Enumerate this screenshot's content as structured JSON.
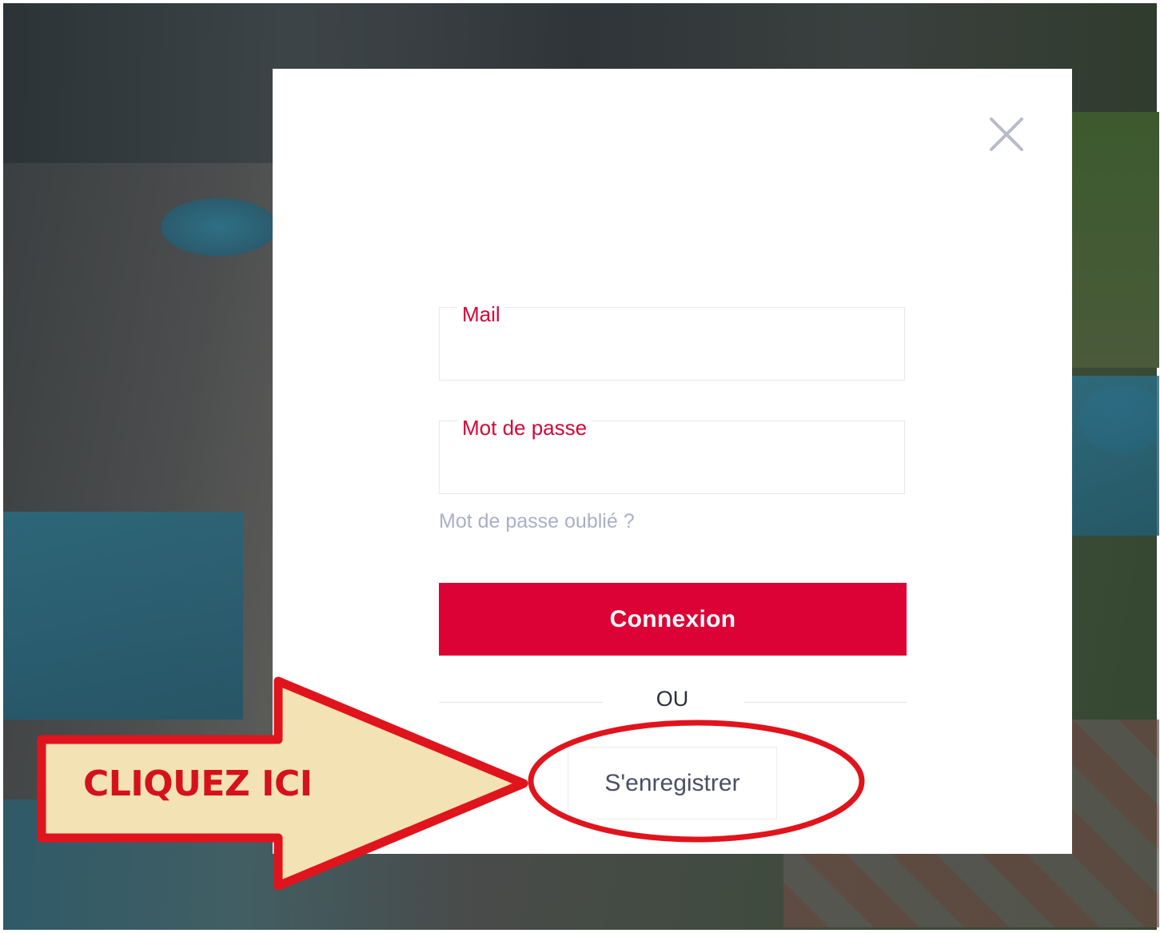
{
  "colors": {
    "accent": "#dc0235",
    "label_red": "#d5063a",
    "link_muted": "#a9afc8",
    "annotation_red": "#e0141c",
    "annotation_fill": "#f2e2b4"
  },
  "modal": {
    "close_icon": "close-icon",
    "fields": {
      "mail_label": "Mail",
      "mail_value": "",
      "password_label": "Mot de passe",
      "password_value": ""
    },
    "forgot_link": "Mot de passe oublié ?",
    "login_button": "Connexion",
    "separator": "OU",
    "register_button": "S'enregistrer"
  },
  "annotation": {
    "arrow_text": "CLIQUEZ ICI"
  }
}
